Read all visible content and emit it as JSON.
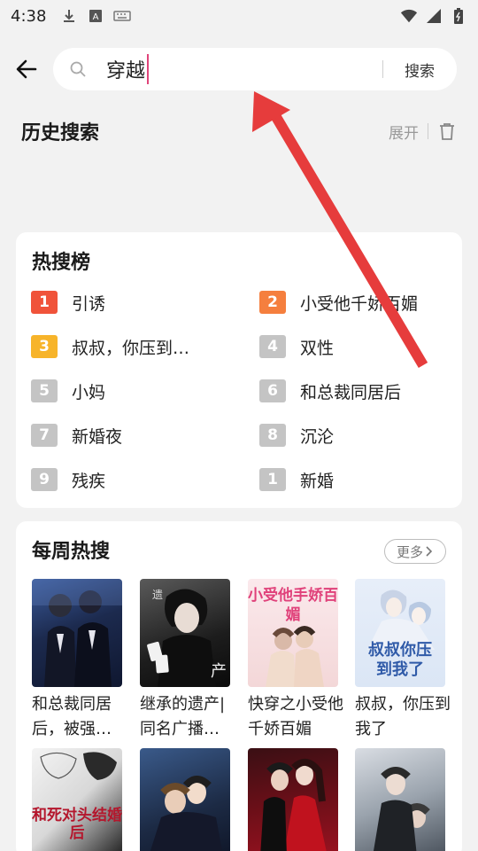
{
  "status_bar": {
    "time": "4:38",
    "left_icons": [
      "download-icon",
      "a-keyboard-icon",
      "keyboard-icon"
    ],
    "right_icons": [
      "wifi-icon",
      "signal-icon",
      "battery-icon"
    ]
  },
  "search": {
    "query": "穿越",
    "button_label": "搜索",
    "icon": "search-icon",
    "back_icon": "back-arrow-icon"
  },
  "history": {
    "title": "历史搜索",
    "expand_label": "展开",
    "delete_icon": "trash-icon"
  },
  "hot_search": {
    "title": "热搜榜",
    "items": [
      {
        "rank": "1",
        "text": "引诱",
        "color": "#f0533a"
      },
      {
        "rank": "2",
        "text": "小受他千娇百媚",
        "color": "#f57f3e"
      },
      {
        "rank": "3",
        "text": "叔叔，你压到…",
        "color": "#f7b42a"
      },
      {
        "rank": "4",
        "text": "双性",
        "color": "#c4c4c4"
      },
      {
        "rank": "5",
        "text": "小妈",
        "color": "#c4c4c4"
      },
      {
        "rank": "6",
        "text": "和总裁同居后",
        "color": "#c4c4c4"
      },
      {
        "rank": "7",
        "text": "新婚夜",
        "color": "#c4c4c4"
      },
      {
        "rank": "8",
        "text": "沉沦",
        "color": "#c4c4c4"
      },
      {
        "rank": "9",
        "text": "残疾",
        "color": "#c4c4c4"
      },
      {
        "rank": "1",
        "text": "新婚",
        "color": "#c4c4c4"
      }
    ]
  },
  "weekly": {
    "title": "每周热搜",
    "more_label": "更多",
    "books": [
      {
        "title": "和总裁同居后，被强…"
      },
      {
        "title": "继承的遗产|同名广播…"
      },
      {
        "title": "快穿之小受他千娇百媚",
        "cover_text": "小受他手娇百媚"
      },
      {
        "title": "叔叔，你压到我了",
        "cover_text": "叔叔你压到我了"
      },
      {
        "title": "",
        "cover_text": "和死对头结婚后"
      },
      {
        "title": ""
      },
      {
        "title": ""
      },
      {
        "title": ""
      }
    ]
  },
  "colors": {
    "accent_caret": "#e0457a",
    "annotation_arrow": "#e63c3c"
  }
}
